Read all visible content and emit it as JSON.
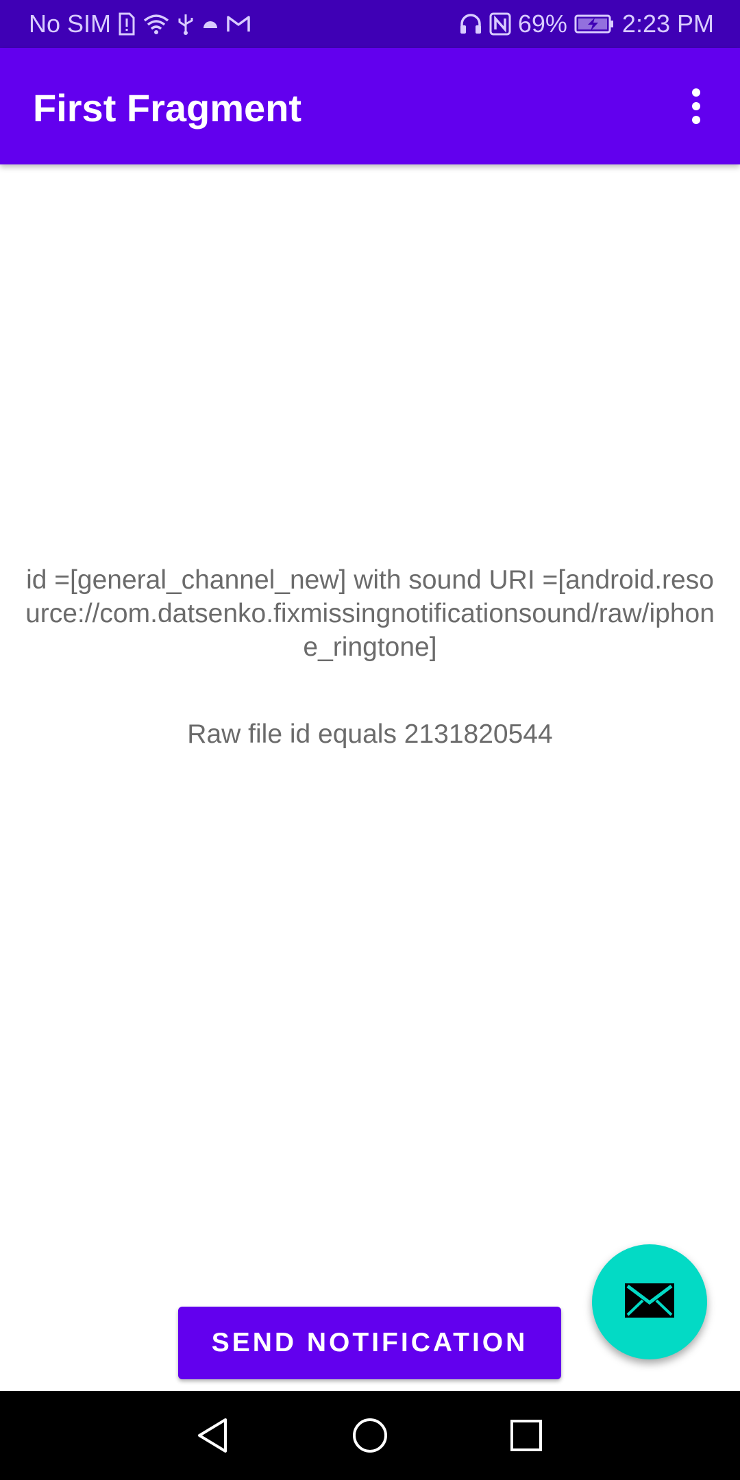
{
  "status_bar": {
    "carrier": "No SIM",
    "battery_percent": "69%",
    "time": "2:23 PM",
    "left_icons": [
      "sim-alert-icon",
      "wifi-icon",
      "usb-icon",
      "android-icon",
      "gmail-icon"
    ],
    "right_icons": [
      "headphones-icon",
      "nfc-icon",
      "battery-charging-icon"
    ],
    "background_color": "#3f00b5"
  },
  "app_bar": {
    "title": "First Fragment",
    "menu_icon": "more-vert-icon",
    "background_color": "#6200ee"
  },
  "content": {
    "channel_info": "id =[general_channel_new] with sound URI =[android.resource://com.datsenko.fixmissingnotificationsound/raw/iphone_ringtone]",
    "raw_file_info": "Raw file id equals 2131820544"
  },
  "buttons": {
    "send_notification": "SEND NOTIFICATION",
    "send_notification_color": "#6200ee"
  },
  "fab": {
    "icon": "email-icon",
    "color": "#03dac5"
  },
  "nav_bar": {
    "icons": [
      "back-icon",
      "home-icon",
      "recents-icon"
    ]
  }
}
